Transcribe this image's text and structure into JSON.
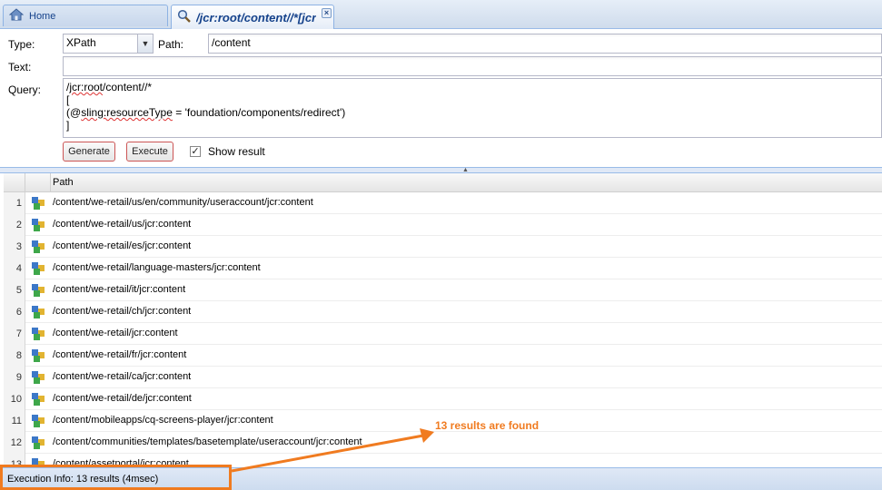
{
  "tabs": {
    "home_label": "Home",
    "query_label": "/jcr:root/content//*[jcr"
  },
  "form": {
    "type_label": "Type:",
    "type_value": "XPath",
    "path_label": "Path:",
    "path_value": "/content",
    "text_label": "Text:",
    "text_value": "",
    "query_label": "Query:",
    "query_lines": [
      "/jcr:root/content//*",
      "[",
      "(@sling:resourceType = 'foundation/components/redirect')",
      "]"
    ],
    "generate_label": "Generate",
    "execute_label": "Execute",
    "show_result_label": "Show result",
    "show_result_checked": true
  },
  "grid": {
    "column_path": "Path",
    "rows": [
      {
        "num": "1",
        "path": "/content/we-retail/us/en/community/useraccount/jcr:content"
      },
      {
        "num": "2",
        "path": "/content/we-retail/us/jcr:content"
      },
      {
        "num": "3",
        "path": "/content/we-retail/es/jcr:content"
      },
      {
        "num": "4",
        "path": "/content/we-retail/language-masters/jcr:content"
      },
      {
        "num": "5",
        "path": "/content/we-retail/it/jcr:content"
      },
      {
        "num": "6",
        "path": "/content/we-retail/ch/jcr:content"
      },
      {
        "num": "7",
        "path": "/content/we-retail/jcr:content"
      },
      {
        "num": "8",
        "path": "/content/we-retail/fr/jcr:content"
      },
      {
        "num": "9",
        "path": "/content/we-retail/ca/jcr:content"
      },
      {
        "num": "10",
        "path": "/content/we-retail/de/jcr:content"
      },
      {
        "num": "11",
        "path": "/content/mobileapps/cq-screens-player/jcr:content"
      },
      {
        "num": "12",
        "path": "/content/communities/templates/basetemplate/useraccount/jcr:content"
      },
      {
        "num": "13",
        "path": "/content/assetportal/jcr:content"
      }
    ]
  },
  "status": {
    "execution_info": "Execution Info:  13 results (4msec)"
  },
  "annotation": {
    "note": "13 results are found",
    "color": "#f07b20"
  }
}
